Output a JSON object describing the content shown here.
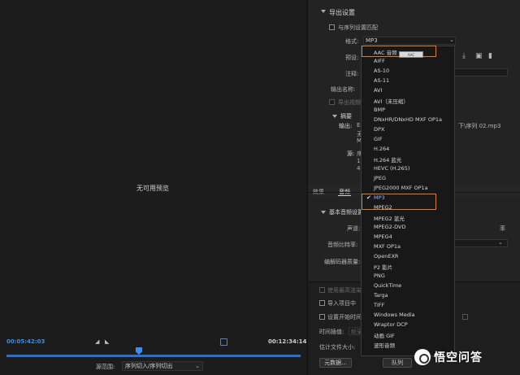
{
  "preview": {
    "no_preview": "无可用预览",
    "timecode_in": "00:05:42:03",
    "timecode_out": "00:12:34:14",
    "source_range_label": "源范围:",
    "source_range_value": "序列切入/序列切出"
  },
  "export": {
    "section_title": "导出设置",
    "match_sequence": "与序列设置匹配",
    "format_label": "格式:",
    "format_value": "MP3",
    "preset_label": "预设:",
    "comment_label": "注释:",
    "output_name_label": "输出名称:",
    "export_video": "导出视频",
    "summary_title": "摘要",
    "output_label": "输出:",
    "output_path_fragment": "E:\\",
    "output_name_fragment": "下\\序列 02.mp3",
    "output_line2": "无",
    "output_line3": "MP",
    "source_label": "源:",
    "source_line1": "序",
    "source_line2": "192",
    "source_line3": "480"
  },
  "tabs": {
    "effects": "效果",
    "audio": "音频"
  },
  "audio_settings": {
    "section_title": "基本音频设置",
    "channels_label": "声道:",
    "bitrate_label": "音频比特率:",
    "codec_quality_label": "编解码器质量:",
    "bitrate_hint": "率"
  },
  "bottom": {
    "max_render": "使用最高渲染质量",
    "import_project": "导入项目中",
    "set_start_tc": "设置开始时间码",
    "time_interp_label": "时间插值:",
    "time_interp_value": "帧采样",
    "est_size_label": "估计文件大小:",
    "metadata_button": "元数据...",
    "queue_button": "队列"
  },
  "dropdown": {
    "items": [
      "AAC 音频",
      "AIFF",
      "AS-10",
      "AS-11",
      "AVI",
      "AVI（未压缩）",
      "BMP",
      "DNxHR/DNxHD MXF OP1a",
      "DPX",
      "GIF",
      "H.264",
      "H.264 蓝光",
      "HEVC (H.265)",
      "JPEG",
      "JPEG2000 MXF OP1a",
      "MP3",
      "MPEG2",
      "MPEG2 蓝光",
      "MPEG2-DVD",
      "MPEG4",
      "MXF OP1a",
      "OpenEXR",
      "P2 影片",
      "PNG",
      "QuickTime",
      "Targa",
      "TIFF",
      "Windows Media",
      "Wraptor DCP",
      "动画 GIF",
      "波形音频"
    ],
    "selected": "MP3",
    "tooltip": "AAC"
  },
  "watermark": {
    "text": "悟空问答"
  },
  "colors": {
    "accent": "#2d6fd1",
    "highlight": "#e07a2c"
  }
}
